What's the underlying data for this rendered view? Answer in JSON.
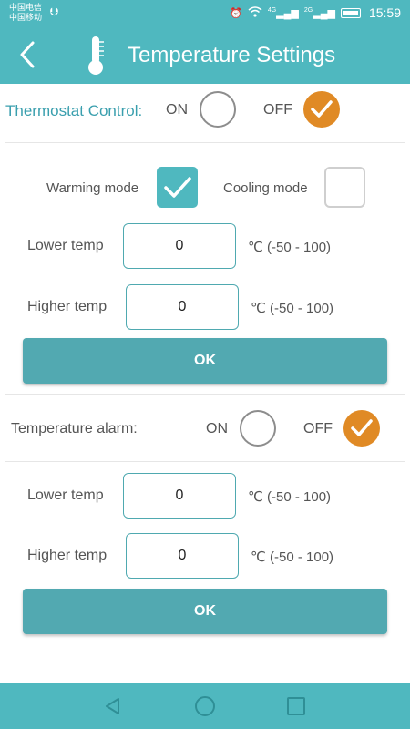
{
  "status_bar": {
    "carrier_1": "中国电信",
    "carrier_2": "中国移动",
    "signal_1": "4G",
    "signal_2": "2G",
    "time": "15:59"
  },
  "header": {
    "title": "Temperature Settings",
    "back_icon": "chevron-left-icon",
    "title_icon": "thermometer-icon"
  },
  "thermostat": {
    "label": "Thermostat Control:",
    "on_label": "ON",
    "off_label": "OFF",
    "selected": "OFF",
    "warming_label": "Warming mode",
    "warming_checked": true,
    "cooling_label": "Cooling mode",
    "cooling_checked": false,
    "lower_label": "Lower temp",
    "lower_value": "0",
    "higher_label": "Higher temp",
    "higher_value": "0",
    "range": "℃ (-50 - 100)",
    "ok_label": "OK"
  },
  "alarm": {
    "label": "Temperature alarm:",
    "on_label": "ON",
    "off_label": "OFF",
    "selected": "OFF",
    "lower_label": "Lower temp",
    "lower_value": "0",
    "higher_label": "Higher temp",
    "higher_value": "0",
    "range": "℃ (-50 - 100)",
    "ok_label": "OK"
  },
  "colors": {
    "accent": "#4fb8bf",
    "button": "#52a9b1",
    "selected": "#e08a25",
    "label_accent": "#3a9fae"
  },
  "nav_bar": [
    "back-triangle-icon",
    "home-circle-icon",
    "recent-square-icon"
  ]
}
